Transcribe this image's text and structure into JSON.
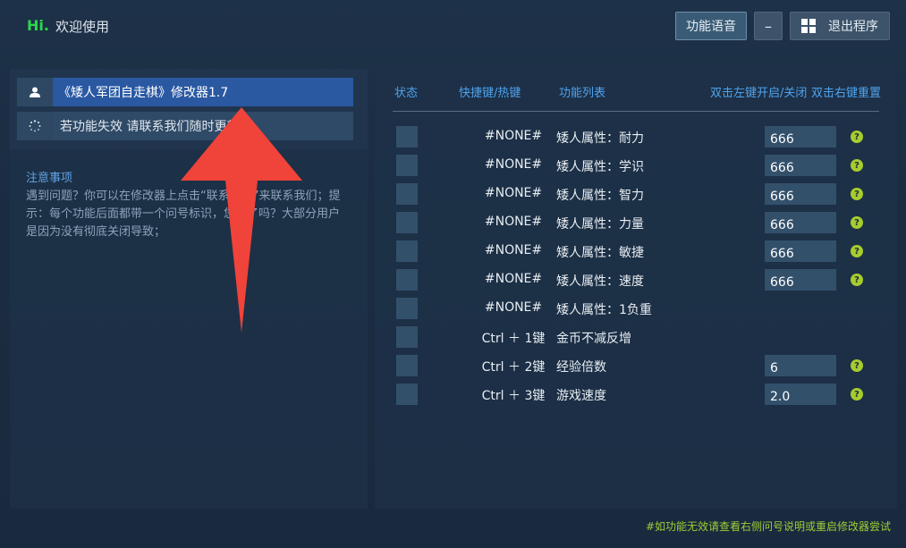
{
  "header": {
    "hi": "Hi.",
    "welcome": "欢迎使用",
    "voice_button": "功能语音",
    "minimize_button": "–",
    "exit_button": "退出程序"
  },
  "left": {
    "title": "《矮人军团自走棋》修改器1.7",
    "warning": "若功能失效 请联系我们随时更新",
    "notice_title": "注意事项",
    "notice_body": "遇到问题？你可以在修改器上点击“联系客服”来联系我们；提示：每个功能后面都带一个问号标识，您看了吗？大部分用户是因为没有彻底关闭导致；"
  },
  "table": {
    "headers": {
      "status": "状态",
      "hotkey": "快捷键/热键",
      "function": "功能列表",
      "left_click": "双击左键开启/关闭",
      "right_click": "双击右键重置"
    },
    "rows": [
      {
        "hotkey": "#NONE#",
        "name": "矮人属性：耐力",
        "value": "666",
        "help": "?"
      },
      {
        "hotkey": "#NONE#",
        "name": "矮人属性：学识",
        "value": "666",
        "help": "?"
      },
      {
        "hotkey": "#NONE#",
        "name": "矮人属性：智力",
        "value": "666",
        "help": "?"
      },
      {
        "hotkey": "#NONE#",
        "name": "矮人属性：力量",
        "value": "666",
        "help": "?"
      },
      {
        "hotkey": "#NONE#",
        "name": "矮人属性：敏捷",
        "value": "666",
        "help": "?"
      },
      {
        "hotkey": "#NONE#",
        "name": "矮人属性：速度",
        "value": "666",
        "help": "?"
      },
      {
        "hotkey": "#NONE#",
        "name": "矮人属性：1负重"
      },
      {
        "hotkey": "Ctrl ＋ 1键",
        "name": "金币不减反增"
      },
      {
        "hotkey": "Ctrl ＋ 2键",
        "name": "经验倍数",
        "value": "6",
        "help": "?"
      },
      {
        "hotkey": "Ctrl ＋ 3键",
        "name": "游戏速度",
        "value": "2.0",
        "help": "?"
      }
    ]
  },
  "footer": "#如功能无效请查看右侧问号说明或重启修改器尝试",
  "colors": {
    "accent_green": "#2bd84b",
    "header_blue": "#4ea3ee",
    "help_green": "#a6cc2e",
    "arrow_red": "#f0433a"
  }
}
